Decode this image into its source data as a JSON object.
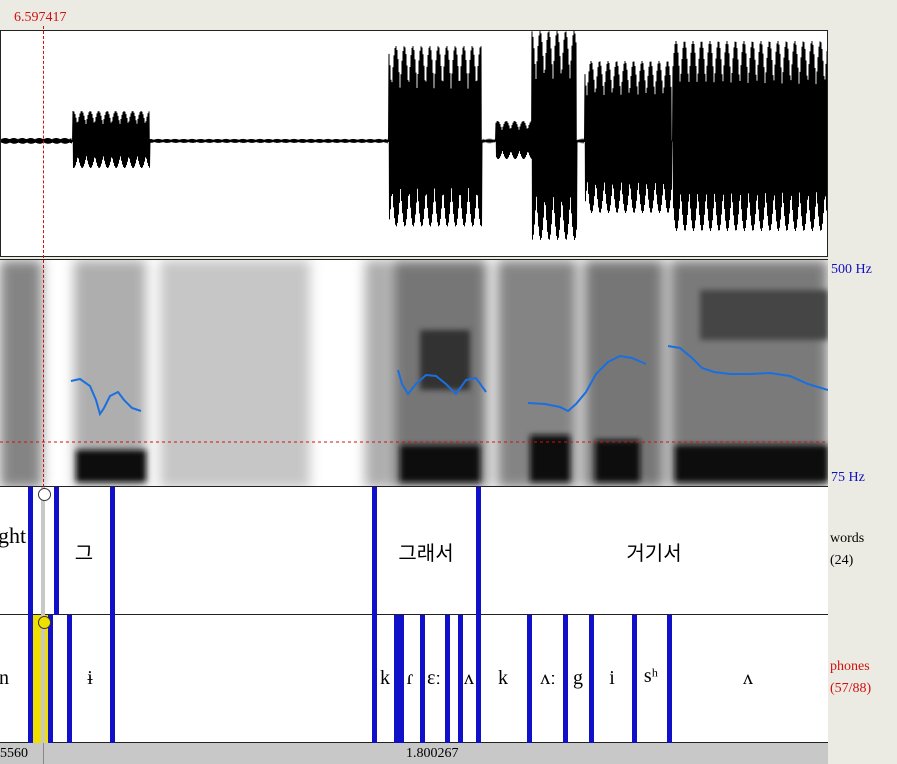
{
  "cursor": {
    "time": "6.597417"
  },
  "spectrogram": {
    "freq_top": "500 Hz",
    "freq_bottom": "75 Hz"
  },
  "tiers": {
    "words": {
      "name": "words",
      "count": "(24)",
      "labels": [
        "ght",
        "그",
        "그래서",
        "거기서"
      ]
    },
    "phones": {
      "name": "phones",
      "count": "(57/88)",
      "labels": [
        "n",
        "ɨ",
        "k",
        "ɾ",
        "ɛː",
        "ʌ",
        "k",
        "ʌː",
        "g",
        "i",
        "sʰ",
        "ʌ"
      ]
    }
  },
  "time_bar": {
    "left": "5560",
    "center": "1.800267"
  },
  "colors": {
    "cursor": "#d01010",
    "pitch": "#1a6fe0",
    "boundary": "#1010c8",
    "phones_label": "#d01010",
    "selection": "#f0e000"
  }
}
